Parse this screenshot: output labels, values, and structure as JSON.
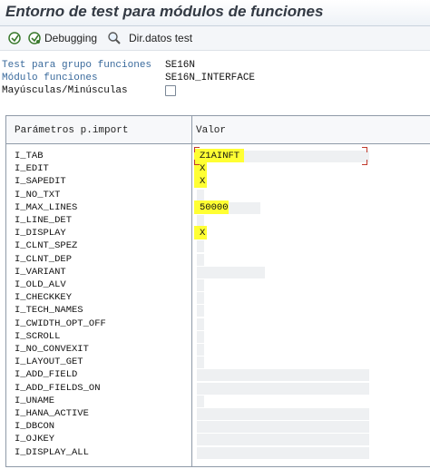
{
  "window": {
    "title": "Entorno de test para módulos de funciones"
  },
  "toolbar": {
    "execute_icon": "execute-icon",
    "debugging_label": "Debugging",
    "dirdatos_label": "Dir.datos test"
  },
  "form": {
    "group_label": "Test para grupo funciones",
    "group_value": "SE16N",
    "module_label": "Módulo funciones",
    "module_value": "SE16N_INTERFACE",
    "case_label": "Mayúsculas/Minúsculas",
    "case_checked": false
  },
  "grid": {
    "col_params": "Parámetros p.import",
    "col_valor": "Valor",
    "rows": [
      {
        "param": "I_TAB",
        "value": "Z1AINFT"
      },
      {
        "param": "I_EDIT",
        "value": "X"
      },
      {
        "param": "I_SAPEDIT",
        "value": "X"
      },
      {
        "param": "I_NO_TXT",
        "value": ""
      },
      {
        "param": "I_MAX_LINES",
        "value": "50000"
      },
      {
        "param": "I_LINE_DET",
        "value": ""
      },
      {
        "param": "I_DISPLAY",
        "value": "X"
      },
      {
        "param": "I_CLNT_SPEZ",
        "value": ""
      },
      {
        "param": "I_CLNT_DEP",
        "value": ""
      },
      {
        "param": "I_VARIANT",
        "value": ""
      },
      {
        "param": "I_OLD_ALV",
        "value": ""
      },
      {
        "param": "I_CHECKKEY",
        "value": ""
      },
      {
        "param": "I_TECH_NAMES",
        "value": ""
      },
      {
        "param": "I_CWIDTH_OPT_OFF",
        "value": ""
      },
      {
        "param": "I_SCROLL",
        "value": ""
      },
      {
        "param": "I_NO_CONVEXIT",
        "value": ""
      },
      {
        "param": "I_LAYOUT_GET",
        "value": ""
      },
      {
        "param": "I_ADD_FIELD",
        "value": ""
      },
      {
        "param": "I_ADD_FIELDS_ON",
        "value": ""
      },
      {
        "param": "I_UNAME",
        "value": ""
      },
      {
        "param": "I_HANA_ACTIVE",
        "value": ""
      },
      {
        "param": "I_DBCON",
        "value": ""
      },
      {
        "param": "I_OJKEY",
        "value": ""
      },
      {
        "param": "I_DISPLAY_ALL",
        "value": ""
      }
    ]
  },
  "colors": {
    "highlight": "#ffff33",
    "label_blue": "#3a6a9c",
    "marker_red": "#c0392b"
  }
}
